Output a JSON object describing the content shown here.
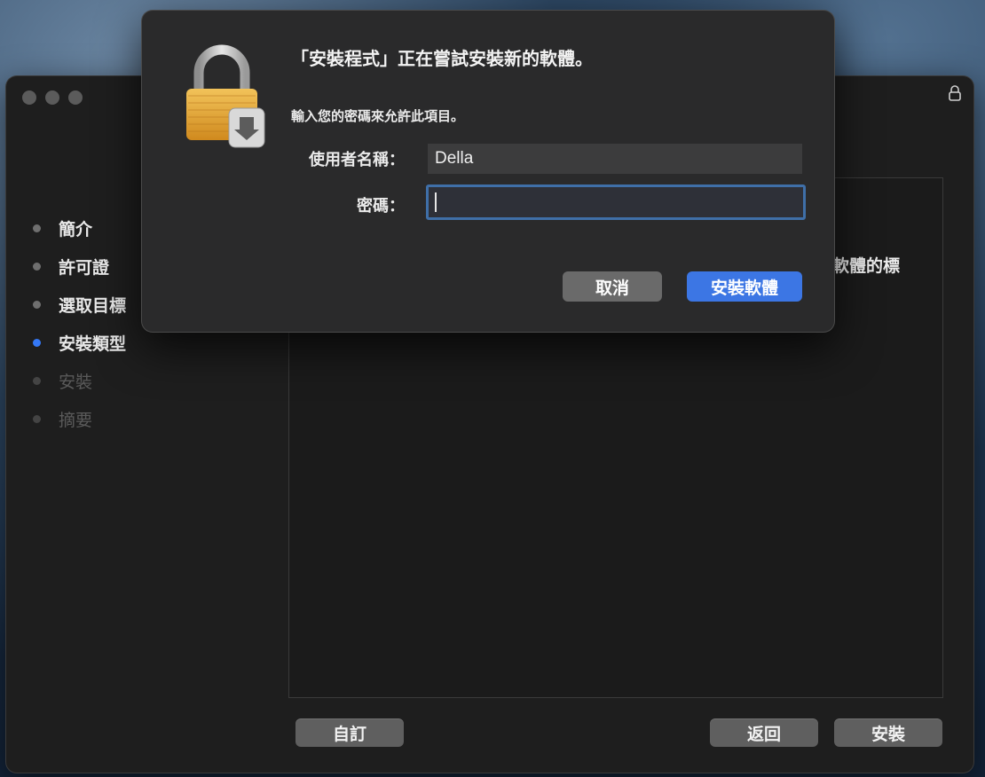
{
  "window": {
    "steps": [
      {
        "label": "簡介",
        "state": "done"
      },
      {
        "label": "許可證",
        "state": "done"
      },
      {
        "label": "選取目標",
        "state": "done"
      },
      {
        "label": "安裝類型",
        "state": "active"
      },
      {
        "label": "安裝",
        "state": "pending"
      },
      {
        "label": "摘要",
        "state": "pending"
      }
    ],
    "content_text_visible": "軟體的標",
    "buttons": {
      "customize": "自訂",
      "back": "返回",
      "install": "安裝"
    }
  },
  "dialog": {
    "title": "「安裝程式」正在嘗試安裝新的軟體。",
    "message": "輸入您的密碼來允許此項目。",
    "username_label": "使用者名稱：",
    "username_value": "Della",
    "password_label": "密碼：",
    "password_value": "",
    "cancel_label": "取消",
    "confirm_label": "安裝軟體"
  },
  "colors": {
    "accent": "#3c76e4",
    "active_step": "#3478f6"
  }
}
